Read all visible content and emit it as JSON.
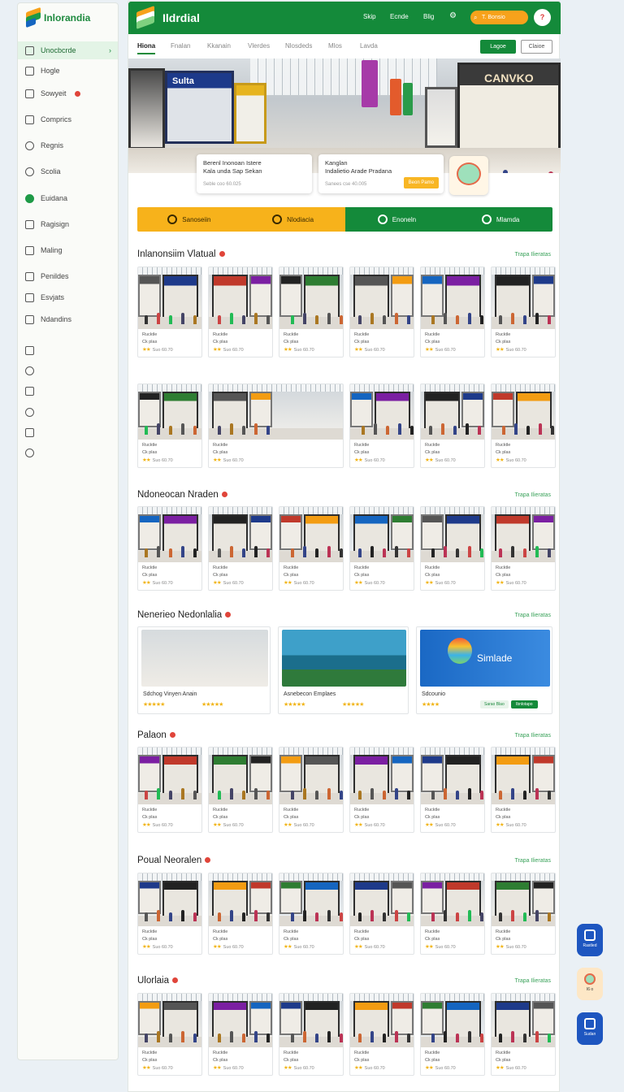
{
  "sidebar": {
    "brand": "Inlorandia",
    "items": [
      {
        "label": "Unocbcrde",
        "icon": "shield-icon",
        "active": true
      },
      {
        "label": "Hogle",
        "icon": "home-icon"
      },
      {
        "label": "Sowyeit",
        "icon": "calendar-icon",
        "badge": true
      },
      {
        "label": "Comprics",
        "icon": "cart-icon"
      },
      {
        "label": "Regnis",
        "icon": "user-icon"
      },
      {
        "label": "Scolia",
        "icon": "chat-icon"
      },
      {
        "label": "Euidana",
        "icon": "chart-icon"
      },
      {
        "label": "Ragisign",
        "icon": "document-icon"
      },
      {
        "label": "Maling",
        "icon": "mail-icon"
      },
      {
        "label": "Penildes",
        "icon": "list-icon"
      },
      {
        "label": "Esvjats",
        "icon": "folder-icon"
      },
      {
        "label": "Ndandins",
        "icon": "grid-icon"
      }
    ],
    "icons_only": [
      "box-icon",
      "gear-icon",
      "tag-icon",
      "bell-icon",
      "smile-icon",
      "clock-icon"
    ]
  },
  "topbar": {
    "title": "Ildrdial",
    "links": [
      "Skip",
      "Ecnde",
      "Blig"
    ],
    "search_placeholder": "T. Bonsio",
    "avatar": "?"
  },
  "tabs": [
    "Hiona",
    "Fnalan",
    "Kkanain",
    "Vlerdes",
    "Nlosdeds",
    "Mlos",
    "Lavda"
  ],
  "buttons": {
    "primary": "Lagoe",
    "secondary": "Claioe"
  },
  "hero": {
    "store_signs": [
      "Sulta",
      "CANVKO"
    ],
    "card1": {
      "line1": "Berenl Inonoan Istere",
      "line2": "Kala unda Sap Sekan",
      "sub": "Seble coo 60.025"
    },
    "card2": {
      "line1": "Kanglan",
      "line2": "Indalietio Arade Pradana",
      "sub": "Sanees cse 40.005",
      "button": "Beon Pamo"
    }
  },
  "actions": [
    {
      "label": "Sanoseiin",
      "bg": "#f7b21b",
      "color": "#3a2a00"
    },
    {
      "label": "Nlodiacia",
      "bg": "#f7b21b",
      "color": "#3a2a00"
    },
    {
      "label": "Enoneln",
      "bg": "#148a3a",
      "color": "#ffffff"
    },
    {
      "label": "Mlamda",
      "bg": "#148a3a",
      "color": "#ffffff"
    }
  ],
  "sections": [
    {
      "title": "Inlanonsiim Vlatual",
      "more": "Trapa Ilieratas"
    },
    {
      "title": "Ndoneocan Nraden",
      "more": "Trapa Ilieratas"
    },
    {
      "title": "Nenerieo Nedonlalia",
      "more": "Trapa Ilieratas"
    },
    {
      "title": "Palaon",
      "more": "Trapa Ilieratas"
    },
    {
      "title": "Poual Neoralen",
      "more": "Trapa Ilieratas"
    },
    {
      "title": "Ulorlaia",
      "more": "Trapa Ilieratas"
    }
  ],
  "card_meta": {
    "name": "Rucktle",
    "sub": "Ck plas",
    "price": "Suo 60.70"
  },
  "wide_cards": [
    {
      "caption": "Sdchog Vinyen Anain"
    },
    {
      "caption": "Asnebecon Emplaes"
    },
    {
      "caption": "Sdcounio",
      "promo": "Simlade",
      "btn1": "Sarao Blao",
      "btn2": "Ibnlotapo"
    }
  ],
  "float_buttons": [
    {
      "label": "Rastled"
    },
    {
      "label": "I6 o"
    },
    {
      "label": "Sudan"
    }
  ]
}
